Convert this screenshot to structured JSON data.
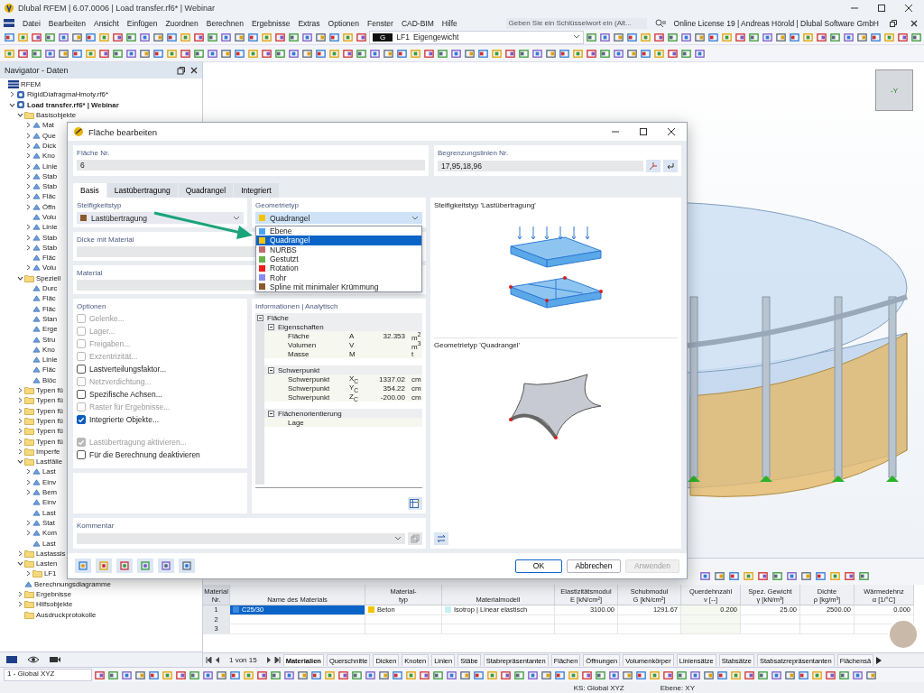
{
  "window": {
    "title": "Dlubal RFEM | 6.07.0006 | Load transfer.rf6* | Webinar"
  },
  "menu": [
    "Datei",
    "Bearbeiten",
    "Ansicht",
    "Einfügen",
    "Zuordnen",
    "Berechnen",
    "Ergebnisse",
    "Extras",
    "Optionen",
    "Fenster",
    "CAD-BIM",
    "Hilfe"
  ],
  "search": {
    "placeholder": "Geben Sie ein Schlüsselwort ein (Alt..."
  },
  "license": "Online License 19 | Andreas Hörold | Dlubal Software GmbH",
  "load_case": {
    "badge": "G",
    "code": "LF1",
    "name": "Eigengewicht"
  },
  "navigator": {
    "title": "Navigator - Daten",
    "tree": [
      {
        "label": "RFEM",
        "kind": "root",
        "children": [
          {
            "label": "RigidDiafragmaHmoty.rf6*",
            "kind": "file",
            "active": false,
            "expanded": false
          },
          {
            "label": "Load transfer.rf6* | Webinar",
            "kind": "file",
            "active": true,
            "expanded": true,
            "children": [
              {
                "label": "Basisobjekte",
                "kind": "folder",
                "expanded": true,
                "children": [
                  {
                    "label": "Mat",
                    "kind": "object",
                    "expanded": false
                  },
                  {
                    "label": "Que",
                    "kind": "object",
                    "expanded": false
                  },
                  {
                    "label": "Dick",
                    "kind": "object",
                    "expanded": false
                  },
                  {
                    "label": "Kno",
                    "kind": "object",
                    "expanded": false
                  },
                  {
                    "label": "Linie",
                    "kind": "object",
                    "expanded": false
                  },
                  {
                    "label": "Stab",
                    "kind": "object",
                    "expanded": false
                  },
                  {
                    "label": "Stab",
                    "kind": "object",
                    "expanded": false
                  },
                  {
                    "label": "Fläc",
                    "kind": "object",
                    "expanded": false
                  },
                  {
                    "label": "Öffn",
                    "kind": "object",
                    "expanded": false
                  },
                  {
                    "label": "Volu",
                    "kind": "object"
                  },
                  {
                    "label": "Linie",
                    "kind": "object",
                    "expanded": false
                  },
                  {
                    "label": "Stab",
                    "kind": "object",
                    "expanded": false
                  },
                  {
                    "label": "Stab",
                    "kind": "object",
                    "expanded": false
                  },
                  {
                    "label": "Fläc",
                    "kind": "object"
                  },
                  {
                    "label": "Volu",
                    "kind": "object",
                    "expanded": false
                  }
                ]
              },
              {
                "label": "Speziell",
                "kind": "folder",
                "expanded": true,
                "children": [
                  {
                    "label": "Durc",
                    "kind": "object"
                  },
                  {
                    "label": "Fläc",
                    "kind": "object"
                  },
                  {
                    "label": "Fläc",
                    "kind": "object"
                  },
                  {
                    "label": "Stan",
                    "kind": "object"
                  },
                  {
                    "label": "Erge",
                    "kind": "object"
                  },
                  {
                    "label": "Stru",
                    "kind": "object"
                  },
                  {
                    "label": "Kno",
                    "kind": "object"
                  },
                  {
                    "label": "Linie",
                    "kind": "object"
                  },
                  {
                    "label": "Fläc",
                    "kind": "object"
                  },
                  {
                    "label": "Blöc",
                    "kind": "object"
                  }
                ]
              },
              {
                "label": "Typen fü",
                "kind": "folder",
                "expanded": false
              },
              {
                "label": "Typen fü",
                "kind": "folder",
                "expanded": false
              },
              {
                "label": "Typen fü",
                "kind": "folder",
                "expanded": false
              },
              {
                "label": "Typen fü",
                "kind": "folder",
                "expanded": false
              },
              {
                "label": "Typen fü",
                "kind": "folder",
                "expanded": false
              },
              {
                "label": "Typen fü",
                "kind": "folder",
                "expanded": false
              },
              {
                "label": "Imperfe",
                "kind": "folder",
                "expanded": false
              },
              {
                "label": "Lastfälle",
                "kind": "folder",
                "expanded": true,
                "children": [
                  {
                    "label": "Last",
                    "kind": "object",
                    "expanded": false
                  },
                  {
                    "label": "Einv",
                    "kind": "object",
                    "expanded": false
                  },
                  {
                    "label": "Bem",
                    "kind": "object",
                    "expanded": false
                  },
                  {
                    "label": "Einv",
                    "kind": "object"
                  },
                  {
                    "label": "Last",
                    "kind": "object"
                  },
                  {
                    "label": "Stat",
                    "kind": "object",
                    "expanded": false
                  },
                  {
                    "label": "Kom",
                    "kind": "object",
                    "expanded": false
                  },
                  {
                    "label": "Last",
                    "kind": "object"
                  }
                ]
              },
              {
                "label": "Lastassis",
                "kind": "folder",
                "expanded": false
              },
              {
                "label": "Lasten",
                "kind": "folder",
                "expanded": true,
                "children": [
                  {
                    "label": "LF1",
                    "kind": "folder",
                    "expanded": false
                  }
                ]
              },
              {
                "label": "Berechnungsdiagramme",
                "kind": "object"
              },
              {
                "label": "Ergebnisse",
                "kind": "folder",
                "expanded": false
              },
              {
                "label": "Hilfsobjekte",
                "kind": "folder",
                "expanded": false
              },
              {
                "label": "Ausdruckprotokolle",
                "kind": "folder"
              }
            ]
          }
        ]
      }
    ]
  },
  "view_cube": {
    "label": "-Y"
  },
  "dialog": {
    "title": "Fläche bearbeiten",
    "number": {
      "label": "Fläche Nr.",
      "value": "6"
    },
    "boundary": {
      "label": "Begrenzungslinien Nr.",
      "value": "17,95,18,96"
    },
    "tabs": [
      {
        "label": "Basis",
        "selected": true
      },
      {
        "label": "Lastübertragung",
        "selected": false
      },
      {
        "label": "Quadrangel",
        "selected": false
      },
      {
        "label": "Integriert",
        "selected": false
      }
    ],
    "stiffness": {
      "label": "Steifigkeitstyp",
      "value": "Lastübertragung",
      "color": "#8b5a2b"
    },
    "geometry": {
      "label": "Geometrietyp",
      "value": "Quadrangel",
      "color": "#f5c400",
      "expanded": true,
      "options": [
        {
          "label": "Ebene",
          "color": "#4da3f0",
          "selected": false
        },
        {
          "label": "Quadrangel",
          "color": "#f5c400",
          "selected": true
        },
        {
          "label": "NURBS",
          "color": "#c06a6a",
          "selected": false
        },
        {
          "label": "Gestutzt",
          "color": "#6ab04c",
          "selected": false
        },
        {
          "label": "Rotation",
          "color": "#ee1c1c",
          "selected": false
        },
        {
          "label": "Rohr",
          "color": "#8a8af0",
          "selected": false
        },
        {
          "label": "Spline mit minimaler Krümmung",
          "color": "#8b5a2b",
          "selected": false
        }
      ]
    },
    "thickness": {
      "label": "Dicke mit Material"
    },
    "material": {
      "label": "Material"
    },
    "options": {
      "label": "Optionen",
      "groups": [
        [
          {
            "label": "Gelenke...",
            "checked": false,
            "disabled": true
          },
          {
            "label": "Lager...",
            "checked": false,
            "disabled": true
          },
          {
            "label": "Freigaben...",
            "checked": false,
            "disabled": true
          },
          {
            "label": "Exzentrizität...",
            "checked": false,
            "disabled": true
          },
          {
            "label": "Lastverteilungsfaktor...",
            "checked": false,
            "disabled": false
          },
          {
            "label": "Netzverdichtung...",
            "checked": false,
            "disabled": true
          },
          {
            "label": "Spezifische Achsen...",
            "checked": false,
            "disabled": false
          },
          {
            "label": "Raster für Ergebnisse...",
            "checked": false,
            "disabled": true
          },
          {
            "label": "Integrierte Objekte...",
            "checked": true,
            "disabled": false
          }
        ],
        [
          {
            "label": "Lastübertragung aktivieren...",
            "checked": true,
            "disabled": true
          },
          {
            "label": "Für die Berechnung deaktivieren",
            "checked": false,
            "disabled": false
          }
        ]
      ]
    },
    "info": {
      "label": "Informationen | Analytisch",
      "root": {
        "label": "Fläche",
        "expanded": true
      },
      "groups": [
        {
          "label": "Eigenschaften",
          "expanded": true,
          "rows": [
            {
              "name": "Fläche",
              "symbol": "A",
              "value": "32.353",
              "unit": "m$^{2}$"
            },
            {
              "name": "Volumen",
              "symbol": "V",
              "unit": "m$^{3}$"
            },
            {
              "name": "Masse",
              "symbol": "M",
              "unit": "t"
            }
          ]
        },
        {
          "label": "Schwerpunkt",
          "expanded": true,
          "rows": [
            {
              "name": "Schwerpunkt",
              "symbol": "X$_{C}$",
              "value": "1337.02",
              "unit": "cm"
            },
            {
              "name": "Schwerpunkt",
              "symbol": "Y$_{C}$",
              "value": "354.22",
              "unit": "cm"
            },
            {
              "name": "Schwerpunkt",
              "symbol": "Z$_{C}$",
              "value": "-200.00",
              "unit": "cm"
            }
          ]
        },
        {
          "label": "Flächenorientierung",
          "expanded": true,
          "rows": [
            {
              "name": "Lage"
            }
          ]
        }
      ]
    },
    "preview_top": "Steifigkeitstyp 'Lastübertragung'",
    "preview_bottom": "Geometrietyp 'Quadrangel'",
    "comment": {
      "label": "Kommentar"
    },
    "buttons": [
      {
        "label": "OK",
        "kind": "default",
        "disabled": false
      },
      {
        "label": "Abbrechen",
        "kind": "normal",
        "disabled": false
      },
      {
        "label": "Anwenden",
        "kind": "normal",
        "disabled": true
      }
    ]
  },
  "table": {
    "columns": [
      "Material\nNr.",
      "Name des Materials",
      "Material-\ntyp",
      "Materialmodell",
      "Elastizitätsmodul\nE [kN/cm²]",
      "Schubmodul\nG [kN/cm²]",
      "Querdehnzahl\nν [--]",
      "Spez. Gewicht\nγ [kN/m³]",
      "Dichte\nρ [kg/m³]",
      "Wärmedehnz\nα [1/°C]"
    ],
    "rows": [
      {
        "number": "1",
        "selected": true,
        "material": {
          "label": "C25/30",
          "color": "#3c8be0"
        },
        "type": {
          "label": "Beton",
          "color": "#f5c400"
        },
        "model": {
          "label": "Isotrop | Linear elastisch",
          "color": "#c8f0f4"
        },
        "values": [
          "3100.00",
          "1291.67",
          "0.200",
          "25.00",
          "2500.00",
          "0.000"
        ]
      },
      {
        "number": "2",
        "selected": false
      },
      {
        "number": "3",
        "selected": false
      }
    ]
  },
  "pager": "1 von 15",
  "sheet_tabs": [
    {
      "label": "Materialien",
      "selected": true
    },
    {
      "label": "Querschnitte",
      "selected": false
    },
    {
      "label": "Dicken",
      "selected": false
    },
    {
      "label": "Knoten",
      "selected": false
    },
    {
      "label": "Linien",
      "selected": false
    },
    {
      "label": "Stäbe",
      "selected": false
    },
    {
      "label": "Stabrepräsentanten",
      "selected": false
    },
    {
      "label": "Flächen",
      "selected": false
    },
    {
      "label": "Öffnungen",
      "selected": false
    },
    {
      "label": "Volumenkörper",
      "selected": false
    },
    {
      "label": "Liniensätze",
      "selected": false
    },
    {
      "label": "Stabsätze",
      "selected": false
    },
    {
      "label": "Stabsatzrepräsentanten",
      "selected": false
    },
    {
      "label": "Flächensä",
      "selected": false
    }
  ],
  "coordinate_system": "1 - Global XYZ",
  "status_bar": {
    "cs": "KS: Global XYZ",
    "plane": "Ebene: XY"
  }
}
